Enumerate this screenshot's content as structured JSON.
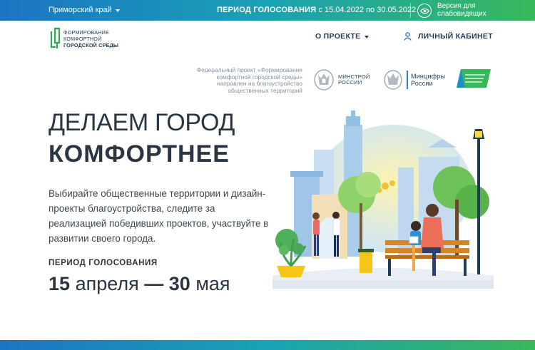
{
  "topbar": {
    "region": "Приморский край",
    "vote_period_label": "ПЕРИОД ГОЛОСОВАНИЯ",
    "vote_period_dates": "с 15.04.2022 по 30.05.2022",
    "vision_line1": "Версия для",
    "vision_line2": "слабовидящих"
  },
  "header": {
    "logo_line1": "ФОРМИРОВАНИЕ",
    "logo_line2": "КОМФОРТНОЙ",
    "logo_line3": "ГОРОДСКОЙ СРЕДЫ",
    "nav_about": "О ПРОЕКТЕ",
    "nav_cabinet": "ЛИЧНЫЙ КАБИНЕТ"
  },
  "partners": {
    "description": "Федеральный проект «Формирование комфортной городской среды» направлен на благоустройство общественных территорий",
    "minstroy_line1": "МИНСТРОЙ",
    "minstroy_line2": "РОССИИ",
    "mincifry_line1": "Минцифры",
    "mincifry_line2": "России"
  },
  "hero": {
    "title_line1": "ДЕЛАЕМ ГОРОД",
    "title_line2": "КОМФОРТНЕЕ",
    "description": "Выбирайте общественные территории и дизайн-проекты благоустройства, следите за реализацией победивших проектов, участвуйте в развитии своего города.",
    "period_label": "ПЕРИОД ГОЛОСОВАНИЯ",
    "date_start_num": "15",
    "date_start_month": "апреля",
    "date_dash": "—",
    "date_end_num": "30",
    "date_end_month": "мая"
  },
  "colors": {
    "gradient_start": "#1b74c4",
    "gradient_mid": "#1aa2b4",
    "gradient_end": "#38b85a",
    "text_dark": "#2b3541",
    "logo_green": "#2fa84f",
    "accent_blue": "#2b7bd0"
  }
}
